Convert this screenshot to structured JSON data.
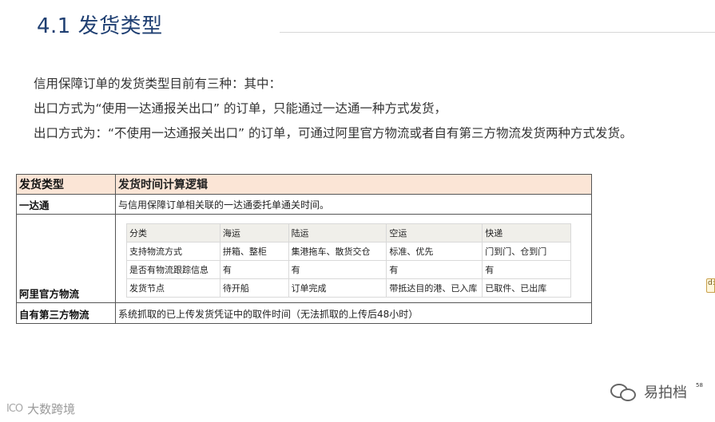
{
  "slide": {
    "title": "4.1 发货类型",
    "intro": [
      "信用保障订单的发货类型目前有三种：其中：",
      "出口方式为“使用一达通报关出口” 的订单，只能通过一达通一种方式发货，",
      "出口方式为：“不使用一达通报关出口” 的订单，可通过阿里官方物流或者自有第三方物流发货两种方式发货。"
    ]
  },
  "main_table": {
    "headers": [
      "发货类型",
      "发货时间计算逻辑"
    ],
    "rows": [
      {
        "type": "一达通",
        "logic": "与信用保障订单相关联的一达通委托单通关时间。"
      },
      {
        "type": "阿里官方物流",
        "logic": ""
      },
      {
        "type": "自有第三方物流",
        "logic": "系统抓取的已上传发货凭证中的取件时间（无法抓取的上传后48小时）"
      }
    ],
    "header_bg": "#fbe5d6"
  },
  "sub_table": {
    "headers": [
      "分类",
      "海运",
      "陆运",
      "空运",
      "快递"
    ],
    "rows": [
      [
        "支持物流方式",
        "拼箱、整柜",
        "集港拖车、散货交仓",
        "标准、优先",
        "门到门、仓到门"
      ],
      [
        "是否有物流跟踪信息",
        "有",
        "有",
        "有",
        "有"
      ],
      [
        "发货节点",
        "待开船",
        "订单完成",
        "带抵达目的港、已入库",
        "已取件、已出库"
      ]
    ]
  },
  "side_tag": "d:",
  "watermarks": {
    "left_logo": "ICO",
    "left_text": "大数跨境",
    "right_text": "易拍档",
    "page_number": "58"
  },
  "colors": {
    "title": "#1f3f72",
    "table_header_bg": "#fbe5d6",
    "sub_header_bg": "#f0efea"
  }
}
